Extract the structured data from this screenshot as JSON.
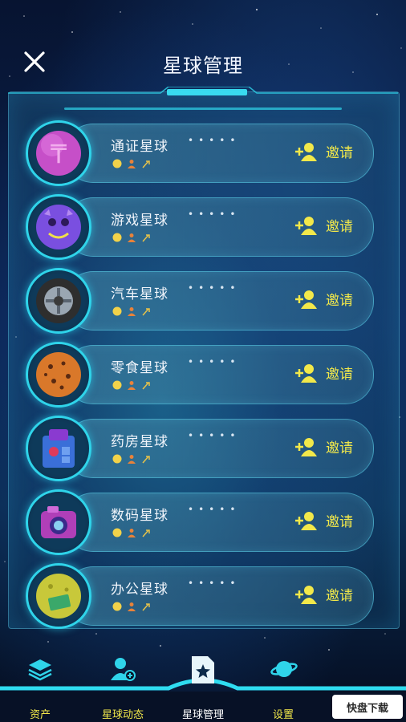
{
  "header": {
    "title": "星球管理",
    "close_icon": "close-icon"
  },
  "planets": [
    {
      "name": "通证星球",
      "dots": "•••••",
      "invite_label": "邀请",
      "icon": "token-planet-icon",
      "color": "#c64fc8"
    },
    {
      "name": "游戏星球",
      "dots": "•••••",
      "invite_label": "邀请",
      "icon": "game-planet-icon",
      "color": "#7a4fe0"
    },
    {
      "name": "汽车星球",
      "dots": "•••••",
      "invite_label": "邀请",
      "icon": "car-planet-icon",
      "color": "#4a4a4a"
    },
    {
      "name": "零食星球",
      "dots": "•••••",
      "invite_label": "邀请",
      "icon": "snack-planet-icon",
      "color": "#d9782a"
    },
    {
      "name": "药房星球",
      "dots": "•••••",
      "invite_label": "邀请",
      "icon": "pharmacy-planet-icon",
      "color": "#3a6fd8"
    },
    {
      "name": "数码星球",
      "dots": "•••••",
      "invite_label": "邀请",
      "icon": "digital-planet-icon",
      "color": "#b03fb8"
    },
    {
      "name": "办公星球",
      "dots": "•••••",
      "invite_label": "邀请",
      "icon": "office-planet-icon",
      "color": "#c8c83a"
    }
  ],
  "tabs": [
    {
      "label": "资产",
      "icon": "layers-icon",
      "active": false
    },
    {
      "label": "星球动态",
      "icon": "user-add-icon",
      "active": false,
      "label_color": "#f2e84a"
    },
    {
      "label": "星球管理",
      "icon": "star-file-icon",
      "active": true
    },
    {
      "label": "设置",
      "icon": "planet-icon",
      "active": false
    }
  ],
  "watermark": "快盘下载",
  "colors": {
    "accent": "#2fd4ea",
    "invite": "#f2e84a",
    "highlight_tab": "#f2e84a"
  }
}
